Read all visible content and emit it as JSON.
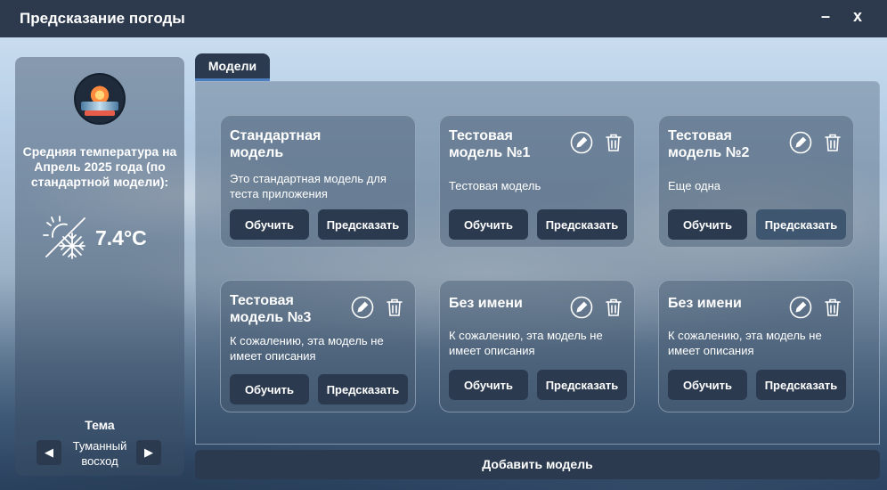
{
  "window": {
    "title": "Предсказание погоды",
    "minimize": "–",
    "close": "x"
  },
  "sidebar": {
    "temp_caption": "Средняя температура на Апрель 2025 года (по стандартной модели):",
    "temp_value": "7.4°C",
    "theme_label": "Тема",
    "theme_name": "Туманный восход",
    "arrow_left": "◀",
    "arrow_right": "▶"
  },
  "tabs": [
    {
      "label": "Модели"
    }
  ],
  "models": [
    {
      "title": "Стандартная модель",
      "description": "Это стандартная модель для теста приложения",
      "train": "Обучить",
      "predict": "Предсказать"
    },
    {
      "title": "Тестовая модель №1",
      "description": "Тестовая модель",
      "train": "Обучить",
      "predict": "Предсказать"
    },
    {
      "title": "Тестовая модель №2",
      "description": "Еще одна",
      "train": "Обучить",
      "predict": "Предсказать"
    },
    {
      "title": "Тестовая модель №3",
      "description": "К сожалению, эта модель не имеет описания",
      "train": "Обучить",
      "predict": "Предсказать"
    },
    {
      "title": "Без имени",
      "description": "К сожалению, эта модель не имеет описания",
      "train": "Обучить",
      "predict": "Предсказать"
    },
    {
      "title": "Без имени",
      "description": "К сожалению, эта модель не имеет описания",
      "train": "Обучить",
      "predict": "Предсказать"
    }
  ],
  "add_model_label": "Добавить модель",
  "colors": {
    "titlebar": "#2d3a4e",
    "button": "#2b3a4f",
    "tab_accent": "#4c7fbf"
  }
}
